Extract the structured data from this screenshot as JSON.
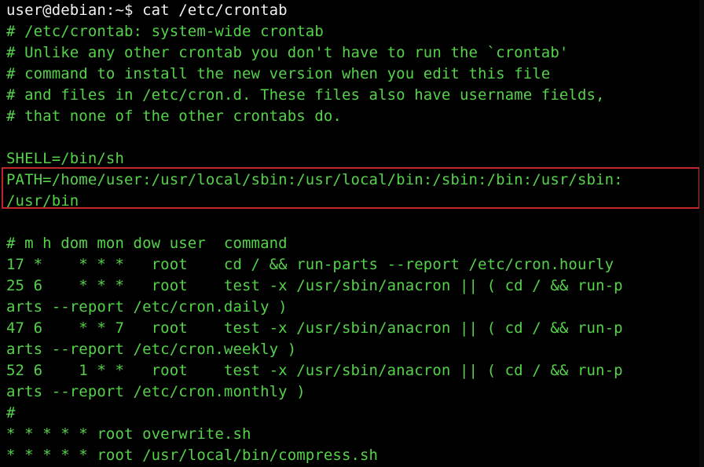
{
  "terminal": {
    "prompt": "user@debian:~$ ",
    "command": "cat /etc/crontab",
    "lines": [
      "# /etc/crontab: system-wide crontab",
      "# Unlike any other crontab you don't have to run the `crontab'",
      "# command to install the new version when you edit this file",
      "# and files in /etc/cron.d. These files also have username fields,",
      "# that none of the other crontabs do.",
      "",
      "SHELL=/bin/sh",
      "PATH=/home/user:/usr/local/sbin:/usr/local/bin:/sbin:/bin:/usr/sbin:",
      "/usr/bin",
      "",
      "# m h dom mon dow user  command",
      "17 *    * * *   root    cd / && run-parts --report /etc/cron.hourly",
      "25 6    * * *   root    test -x /usr/sbin/anacron || ( cd / && run-p",
      "arts --report /etc/cron.daily )",
      "47 6    * * 7   root    test -x /usr/sbin/anacron || ( cd / && run-p",
      "arts --report /etc/cron.weekly )",
      "52 6    1 * *   root    test -x /usr/sbin/anacron || ( cd / && run-p",
      "arts --report /etc/cron.monthly )",
      "#",
      "* * * * * root overwrite.sh",
      "* * * * * root /usr/local/bin/compress.sh"
    ]
  },
  "colors": {
    "background": "#000000",
    "text": "#55d24a",
    "prompt": "#f0f0f0",
    "highlight_border": "#c0262b"
  }
}
